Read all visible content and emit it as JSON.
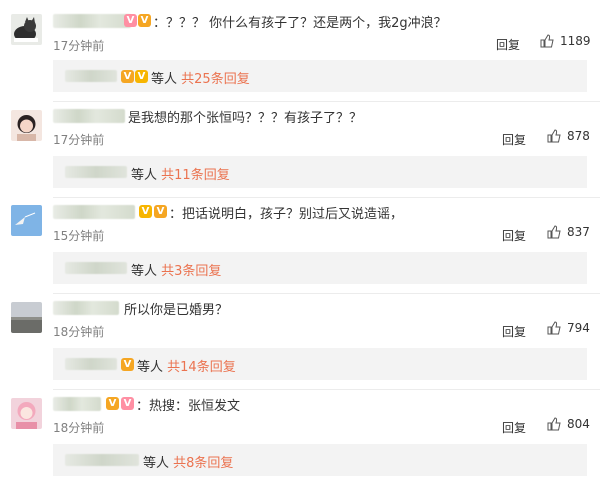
{
  "comments": [
    {
      "text": "：？？？ 你什么有孩子了？还是两个，我2g冲浪？",
      "time": "17分钟前",
      "reply_label": "回复",
      "likes": "1189",
      "replies": {
        "prefix": "等人",
        "count_text": "共25条回复"
      }
    },
    {
      "text": "是我想的那个张恒吗？？？有孩子了？？",
      "time": "17分钟前",
      "reply_label": "回复",
      "likes": "878",
      "replies": {
        "prefix": "等人",
        "count_text": "共11条回复"
      }
    },
    {
      "text": "：把话说明白，孩子？别过后又说造谣，",
      "time": "15分钟前",
      "reply_label": "回复",
      "likes": "837",
      "replies": {
        "prefix": "等人",
        "count_text": "共3条回复"
      }
    },
    {
      "text": "所以你是已婚男？",
      "time": "18分钟前",
      "reply_label": "回复",
      "likes": "794",
      "replies": {
        "prefix": "等人",
        "count_text": "共14条回复"
      }
    },
    {
      "text": "：热搜：张恒发文",
      "time": "18分钟前",
      "reply_label": "回复",
      "likes": "804",
      "replies": {
        "prefix": "等人",
        "count_text": "共8条回复"
      }
    }
  ],
  "colors": {
    "accent": "#eb7350",
    "muted": "#808080",
    "reply_bg": "#f3f3f3"
  },
  "icons": {
    "like": "thumbs-up-icon",
    "vip": "vip-badge-icon"
  }
}
